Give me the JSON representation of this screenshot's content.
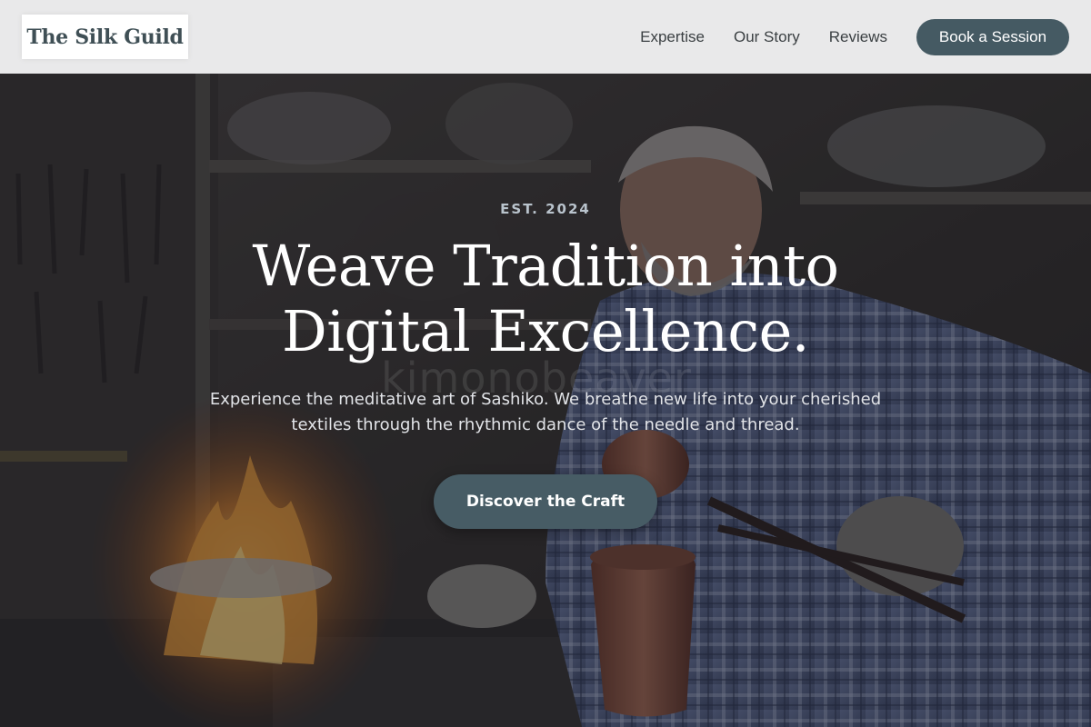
{
  "header": {
    "logo_text": "The Silk Guild",
    "nav": [
      {
        "label": "Expertise"
      },
      {
        "label": "Our Story"
      },
      {
        "label": "Reviews"
      }
    ],
    "cta_label": "Book a Session"
  },
  "hero": {
    "eyebrow": "EST. 2024",
    "headline_line1": "Weave Tradition into",
    "headline_line2": "Digital Excellence.",
    "subtext_line1": "Experience the meditative art of Sashiko. We breathe new life into your cherished",
    "subtext_line2": "textiles through the rhythmic dance of the needle and thread.",
    "cta_label": "Discover the Craft",
    "watermark_text": "kimonobeaver"
  },
  "colors": {
    "accent": "#455a63",
    "header_bg": "#e9e9ea",
    "logo_text": "#3f4f55"
  }
}
